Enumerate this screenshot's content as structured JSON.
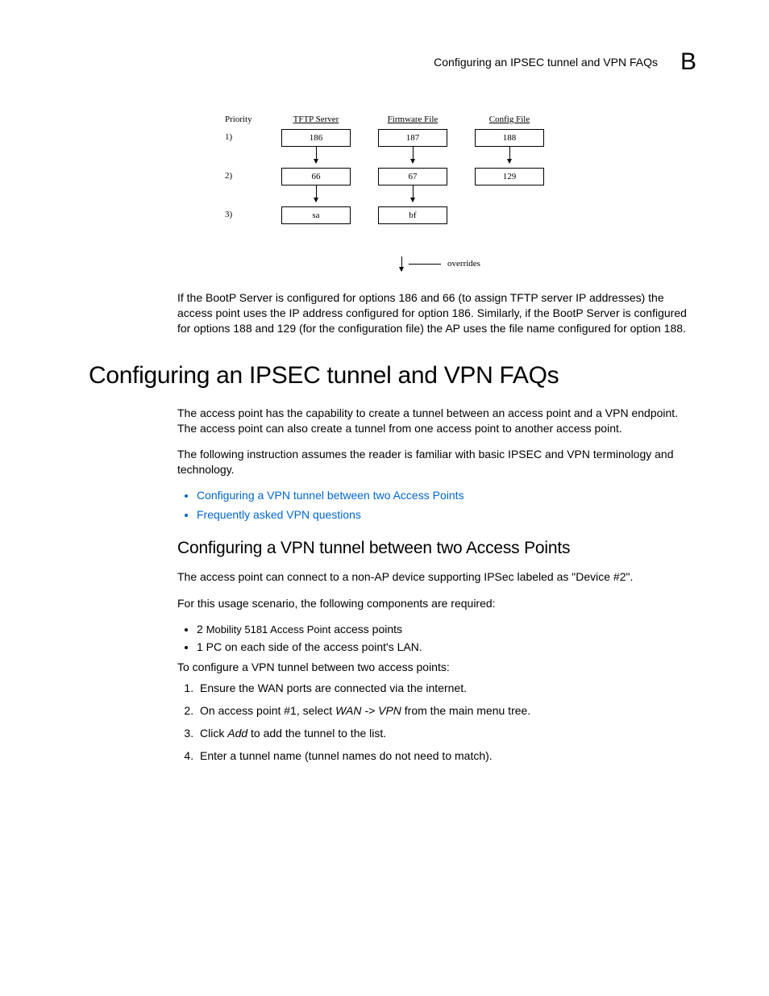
{
  "header": {
    "title": "Configuring an IPSEC tunnel and VPN FAQs",
    "appendix": "B"
  },
  "diagram": {
    "col_priority": "Priority",
    "col_tftp": "TFTP Server",
    "col_firmware": "Firmware File",
    "col_config": "Config File",
    "rows": [
      {
        "n": "1)",
        "tftp": "186",
        "fw": "187",
        "cfg": "188"
      },
      {
        "n": "2)",
        "tftp": "66",
        "fw": "67",
        "cfg": "129"
      },
      {
        "n": "3)",
        "tftp": "sa",
        "fw": "bf",
        "cfg": ""
      }
    ],
    "override_label": "overrides"
  },
  "intro_para": "If the BootP Server is configured for options 186 and 66 (to assign TFTP server IP addresses) the access point uses the IP address configured for option 186. Similarly, if the BootP Server is configured for options 188 and 129 (for the configuration file) the AP uses the file name configured for option 188.",
  "section_title": "Configuring an IPSEC tunnel and VPN FAQs",
  "section_p1": "The access point has the capability to create a tunnel between an access point and a VPN endpoint. The access point can also create a tunnel from one access point to another access point.",
  "section_p2": "The following instruction assumes the reader is familiar with basic IPSEC and VPN terminology and technology.",
  "links": [
    "Configuring a VPN tunnel between two Access Points",
    "Frequently asked VPN questions"
  ],
  "subsection_title": "Configuring a VPN tunnel between two Access Points",
  "sub_p1": "The access point can connect to a non-AP device supporting IPSec labeled as \"Device #2\".",
  "sub_p2": "For this usage scenario, the following components are required:",
  "req": {
    "item1_prefix": "2 ",
    "item1_mid": "Mobility 5181 Access Point",
    "item1_suffix": " access points",
    "item2": "1 PC on each side of the access point's LAN."
  },
  "sub_p3": "To configure a VPN tunnel between two access points:",
  "steps": {
    "s1": "Ensure the WAN ports are connected via the internet.",
    "s2_a": "On access point #1, select ",
    "s2_i": "WAN -> VPN",
    "s2_b": " from the main menu tree.",
    "s3_a": "Click ",
    "s3_i": "Add",
    "s3_b": " to add the tunnel to the list.",
    "s4": "Enter a tunnel name (tunnel names do not need to match)."
  }
}
